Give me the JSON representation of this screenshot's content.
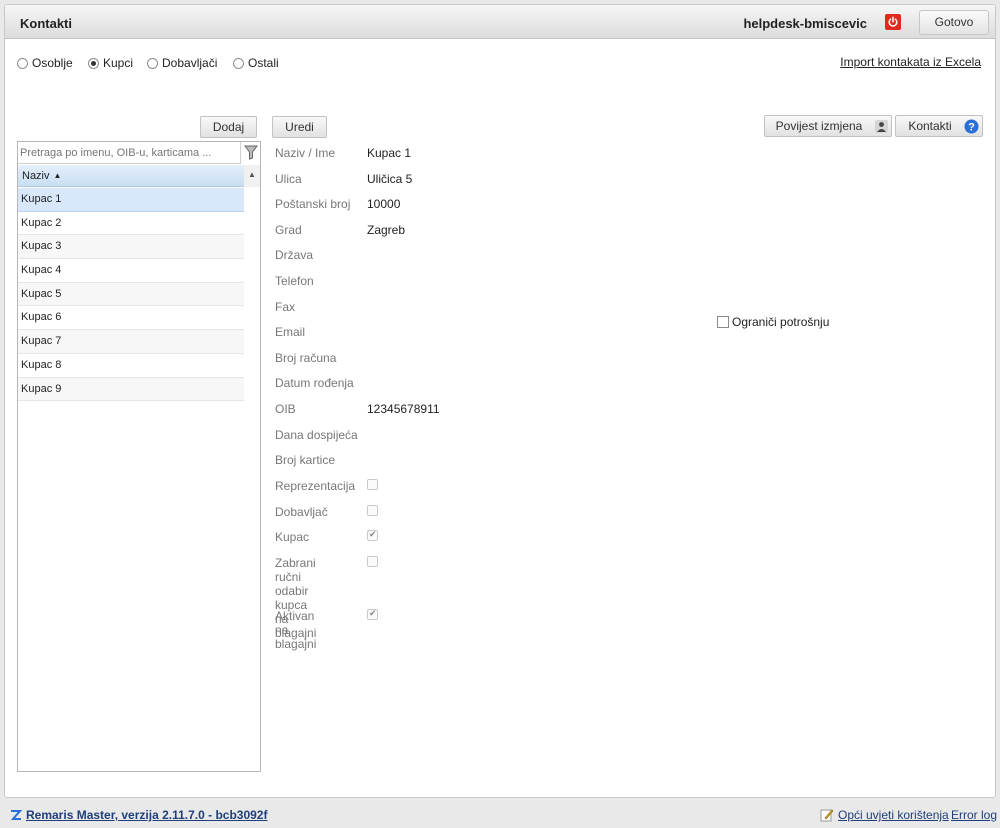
{
  "header": {
    "title": "Kontakti",
    "user": "helpdesk-bmiscevic",
    "done_label": "Gotovo"
  },
  "filters": {
    "options": [
      {
        "label": "Osoblje",
        "checked": false
      },
      {
        "label": "Kupci",
        "checked": true
      },
      {
        "label": "Dobavljači",
        "checked": false
      },
      {
        "label": "Ostali",
        "checked": false
      }
    ],
    "import_link": "Import kontakata iz Excela"
  },
  "toolbar": {
    "add_label": "Dodaj",
    "edit_label": "Uredi",
    "history_label": "Povijest izmjena",
    "contacts_label": "Kontakti"
  },
  "list": {
    "search_placeholder": "Pretraga po imenu, OIB-u, karticama ...",
    "column_header": "Naziv",
    "items": [
      "Kupac 1",
      "Kupac 2",
      "Kupac 3",
      "Kupac 4",
      "Kupac 5",
      "Kupac 6",
      "Kupac 7",
      "Kupac 8",
      "Kupac 9"
    ],
    "selected_item": "Kupac 1"
  },
  "detail": {
    "fields": [
      {
        "label": "Naziv / Ime",
        "value": "Kupac 1"
      },
      {
        "label": "Ulica",
        "value": "Uličica 5"
      },
      {
        "label": "Poštanski broj",
        "value": "10000"
      },
      {
        "label": "Grad",
        "value": "Zagreb"
      },
      {
        "label": "Država",
        "value": ""
      },
      {
        "label": "Telefon",
        "value": ""
      },
      {
        "label": "Fax",
        "value": ""
      },
      {
        "label": "Email",
        "value": ""
      },
      {
        "label": "Broj računa",
        "value": ""
      },
      {
        "label": "Datum rođenja",
        "value": ""
      },
      {
        "label": "OIB",
        "value": "12345678911"
      },
      {
        "label": "Dana dospijeća",
        "value": ""
      },
      {
        "label": "Broj kartice",
        "value": ""
      }
    ],
    "checks": [
      {
        "label": "Reprezentacija",
        "checked": false
      },
      {
        "label": "Dobavljač",
        "checked": false
      },
      {
        "label": "Kupac",
        "checked": true
      },
      {
        "label": "Zabrani ručni\nodabir kupca\nna blagajni",
        "checked": false
      },
      {
        "label": "Aktivan na\nblagajni",
        "checked": true
      }
    ],
    "limit_label": "Ograniči potrošnju"
  },
  "footer": {
    "version": "Remaris Master, verzija 2.11.7.0 - bcb3092f",
    "terms": "Opći uvjeti korištenja",
    "error_log": "Error log"
  }
}
